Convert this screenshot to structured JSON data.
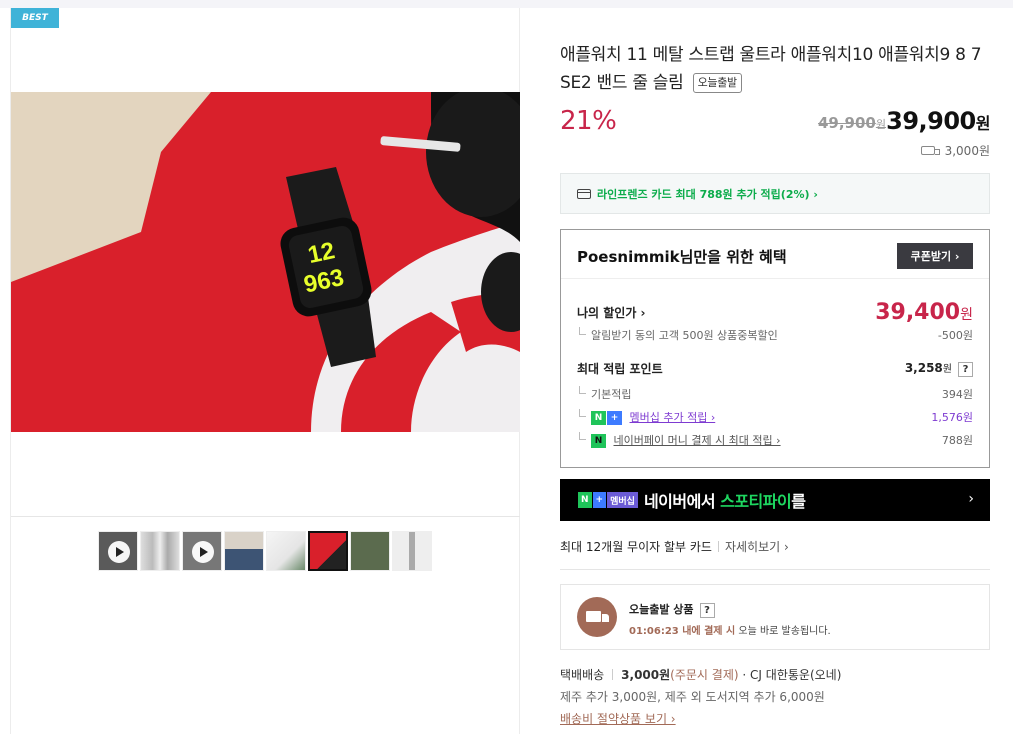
{
  "gallery": {
    "badge": "BEST",
    "thumbnails": [
      {
        "name": "thumb-video-1",
        "video": true
      },
      {
        "name": "thumb-silver-bands",
        "video": false
      },
      {
        "name": "thumb-video-2",
        "video": true
      },
      {
        "name": "thumb-wrist-jeans",
        "video": false
      },
      {
        "name": "thumb-white-shirt",
        "video": false
      },
      {
        "name": "thumb-red-towel",
        "video": false,
        "selected": true
      },
      {
        "name": "thumb-olive",
        "video": false
      },
      {
        "name": "thumb-white-band",
        "video": false
      }
    ]
  },
  "product": {
    "title": "애플워치 11 메탈 스트랩 울트라 애플워치10 애플워치9 8 7 SE2 밴드 줄 슬림",
    "tag": "오늘출발",
    "discount": "21%",
    "original_price": "49,900",
    "original_price_unit": "원",
    "sale_price": "39,900",
    "sale_price_unit": "원",
    "shipping_fee": "3,000원"
  },
  "card_promo": "라인프렌즈 카드 최대 788원 추가 적립(2%) ›",
  "benefits": {
    "heading": "Poesnimmik님만을 위한 혜택",
    "coupon_button": "쿠폰받기 ›",
    "my_price_label": "나의 할인가 ›",
    "my_price": "39,400",
    "my_price_unit": "원",
    "alarm_label": "알림받기 동의 고객 500원 상품중복할인",
    "alarm_value": "-500원",
    "max_points_label": "최대 적립 포인트",
    "max_points": "3,258",
    "max_points_unit": "원",
    "help": "?",
    "basic_label": "기본적립",
    "basic_value": "394원",
    "membership_label": "멤버십 추가 적립 ›",
    "membership_value": "1,576원",
    "npay_label": "네이버페이 머니 결제 시 최대 적립 ›",
    "npay_value": "788원",
    "nplus_n": "N",
    "nplus_plus": "+",
    "npay_n": "N"
  },
  "spotify": {
    "n": "N",
    "plus": "+",
    "tag": "멤버십",
    "text_before": "네이버에서 ",
    "highlight": "스포티파이",
    "text_after": "를",
    "arrow": "›"
  },
  "installment": {
    "text": "최대 12개월 무이자 할부 카드",
    "more": "자세히보기 ›"
  },
  "today_ship": {
    "title": "오늘출발 상품",
    "help": "?",
    "time": "01:06:23 내에 결제 시",
    "desc": " 오늘 바로 발송됩니다."
  },
  "delivery": {
    "method": "택배배송",
    "fee": "3,000원",
    "fee_note": "(주문시 결제)",
    "dot": "·",
    "carrier": "CJ 대한통운(오네)",
    "extra": "제주 추가 3,000원, 제주 외 도서지역 추가 6,000원",
    "saving_link": "배송비 절약상품 보기 ›"
  },
  "colors": {
    "discount": "#c8254a",
    "green": "#0cac4b",
    "spotify_green": "#1ed760",
    "brown": "#a26a57",
    "purple": "#7e3bd1"
  }
}
